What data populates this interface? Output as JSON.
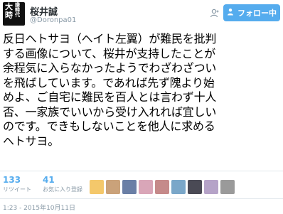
{
  "user": {
    "avatar_text_main": "大嫌韓時代",
    "avatar_col1": "大時",
    "avatar_col2": "嫌韓代",
    "name": "桜井誠",
    "handle": "@Doronpa01"
  },
  "follow": {
    "label": "フォロー中",
    "icon": "follow-person-icon"
  },
  "tweet_lines": [
    "反日ヘトサヨ（ヘイト左翼）が難民を批判",
    "する画像について、桜井が支持したことが",
    "余程気に入らなかったようでわざわざつい",
    "を飛ばしています。であれば先ず隗より始",
    "めよ、ご自宅に難民を百人とは言わず十人",
    "否、一家族でいいから受け入れれば宜しい",
    "のです。できもしないことを他人に求める",
    "ヘトサヨ。"
  ],
  "stats": {
    "retweets": {
      "count": "133",
      "label": "リツイート"
    },
    "likes": {
      "count": "41",
      "label": "お気に入り登録"
    }
  },
  "liker_avatars": [
    {
      "name": "avatar-1",
      "color": "#f4c86b"
    },
    {
      "name": "avatar-2",
      "color": "#caa27a"
    },
    {
      "name": "avatar-3",
      "color": "#6a7fa6"
    },
    {
      "name": "avatar-4",
      "color": "#d9a6b8"
    },
    {
      "name": "avatar-5",
      "color": "#c58a8a"
    },
    {
      "name": "avatar-6",
      "color": "#7aa7c9"
    },
    {
      "name": "avatar-7",
      "color": "#4a4a55"
    },
    {
      "name": "avatar-8",
      "color": "#b5a3c8"
    },
    {
      "name": "avatar-9",
      "color": "#9a9a9a"
    }
  ],
  "timestamp": "1:23 - 2015年10月11日",
  "colors": {
    "accent": "#55acee",
    "muted": "#8899a6",
    "divider": "#e1e8ed"
  }
}
